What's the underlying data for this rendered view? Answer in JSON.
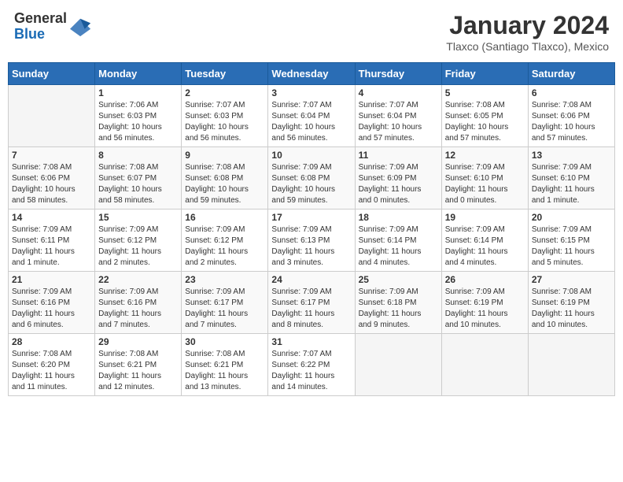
{
  "header": {
    "logo_general": "General",
    "logo_blue": "Blue",
    "month_year": "January 2024",
    "location": "Tlaxco (Santiago Tlaxco), Mexico"
  },
  "weekdays": [
    "Sunday",
    "Monday",
    "Tuesday",
    "Wednesday",
    "Thursday",
    "Friday",
    "Saturday"
  ],
  "weeks": [
    [
      {
        "day": "",
        "info": ""
      },
      {
        "day": "1",
        "info": "Sunrise: 7:06 AM\nSunset: 6:03 PM\nDaylight: 10 hours\nand 56 minutes."
      },
      {
        "day": "2",
        "info": "Sunrise: 7:07 AM\nSunset: 6:03 PM\nDaylight: 10 hours\nand 56 minutes."
      },
      {
        "day": "3",
        "info": "Sunrise: 7:07 AM\nSunset: 6:04 PM\nDaylight: 10 hours\nand 56 minutes."
      },
      {
        "day": "4",
        "info": "Sunrise: 7:07 AM\nSunset: 6:04 PM\nDaylight: 10 hours\nand 57 minutes."
      },
      {
        "day": "5",
        "info": "Sunrise: 7:08 AM\nSunset: 6:05 PM\nDaylight: 10 hours\nand 57 minutes."
      },
      {
        "day": "6",
        "info": "Sunrise: 7:08 AM\nSunset: 6:06 PM\nDaylight: 10 hours\nand 57 minutes."
      }
    ],
    [
      {
        "day": "7",
        "info": "Sunrise: 7:08 AM\nSunset: 6:06 PM\nDaylight: 10 hours\nand 58 minutes."
      },
      {
        "day": "8",
        "info": "Sunrise: 7:08 AM\nSunset: 6:07 PM\nDaylight: 10 hours\nand 58 minutes."
      },
      {
        "day": "9",
        "info": "Sunrise: 7:08 AM\nSunset: 6:08 PM\nDaylight: 10 hours\nand 59 minutes."
      },
      {
        "day": "10",
        "info": "Sunrise: 7:09 AM\nSunset: 6:08 PM\nDaylight: 10 hours\nand 59 minutes."
      },
      {
        "day": "11",
        "info": "Sunrise: 7:09 AM\nSunset: 6:09 PM\nDaylight: 11 hours\nand 0 minutes."
      },
      {
        "day": "12",
        "info": "Sunrise: 7:09 AM\nSunset: 6:10 PM\nDaylight: 11 hours\nand 0 minutes."
      },
      {
        "day": "13",
        "info": "Sunrise: 7:09 AM\nSunset: 6:10 PM\nDaylight: 11 hours\nand 1 minute."
      }
    ],
    [
      {
        "day": "14",
        "info": "Sunrise: 7:09 AM\nSunset: 6:11 PM\nDaylight: 11 hours\nand 1 minute."
      },
      {
        "day": "15",
        "info": "Sunrise: 7:09 AM\nSunset: 6:12 PM\nDaylight: 11 hours\nand 2 minutes."
      },
      {
        "day": "16",
        "info": "Sunrise: 7:09 AM\nSunset: 6:12 PM\nDaylight: 11 hours\nand 2 minutes."
      },
      {
        "day": "17",
        "info": "Sunrise: 7:09 AM\nSunset: 6:13 PM\nDaylight: 11 hours\nand 3 minutes."
      },
      {
        "day": "18",
        "info": "Sunrise: 7:09 AM\nSunset: 6:14 PM\nDaylight: 11 hours\nand 4 minutes."
      },
      {
        "day": "19",
        "info": "Sunrise: 7:09 AM\nSunset: 6:14 PM\nDaylight: 11 hours\nand 4 minutes."
      },
      {
        "day": "20",
        "info": "Sunrise: 7:09 AM\nSunset: 6:15 PM\nDaylight: 11 hours\nand 5 minutes."
      }
    ],
    [
      {
        "day": "21",
        "info": "Sunrise: 7:09 AM\nSunset: 6:16 PM\nDaylight: 11 hours\nand 6 minutes."
      },
      {
        "day": "22",
        "info": "Sunrise: 7:09 AM\nSunset: 6:16 PM\nDaylight: 11 hours\nand 7 minutes."
      },
      {
        "day": "23",
        "info": "Sunrise: 7:09 AM\nSunset: 6:17 PM\nDaylight: 11 hours\nand 7 minutes."
      },
      {
        "day": "24",
        "info": "Sunrise: 7:09 AM\nSunset: 6:17 PM\nDaylight: 11 hours\nand 8 minutes."
      },
      {
        "day": "25",
        "info": "Sunrise: 7:09 AM\nSunset: 6:18 PM\nDaylight: 11 hours\nand 9 minutes."
      },
      {
        "day": "26",
        "info": "Sunrise: 7:09 AM\nSunset: 6:19 PM\nDaylight: 11 hours\nand 10 minutes."
      },
      {
        "day": "27",
        "info": "Sunrise: 7:08 AM\nSunset: 6:19 PM\nDaylight: 11 hours\nand 10 minutes."
      }
    ],
    [
      {
        "day": "28",
        "info": "Sunrise: 7:08 AM\nSunset: 6:20 PM\nDaylight: 11 hours\nand 11 minutes."
      },
      {
        "day": "29",
        "info": "Sunrise: 7:08 AM\nSunset: 6:21 PM\nDaylight: 11 hours\nand 12 minutes."
      },
      {
        "day": "30",
        "info": "Sunrise: 7:08 AM\nSunset: 6:21 PM\nDaylight: 11 hours\nand 13 minutes."
      },
      {
        "day": "31",
        "info": "Sunrise: 7:07 AM\nSunset: 6:22 PM\nDaylight: 11 hours\nand 14 minutes."
      },
      {
        "day": "",
        "info": ""
      },
      {
        "day": "",
        "info": ""
      },
      {
        "day": "",
        "info": ""
      }
    ]
  ]
}
